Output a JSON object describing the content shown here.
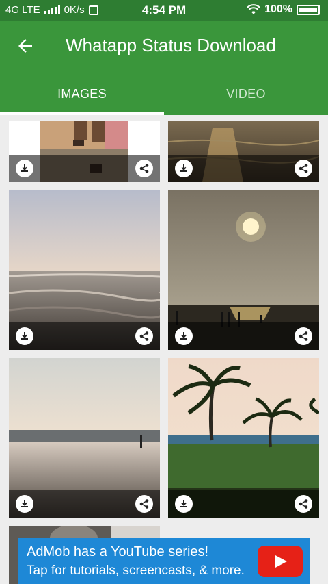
{
  "status_bar": {
    "network": "4G LTE",
    "speed": "0K/s",
    "time": "4:54 PM",
    "battery": "100%"
  },
  "app_bar": {
    "title": "Whatapp Status Download"
  },
  "tabs": [
    {
      "label": "IMAGES",
      "active": true
    },
    {
      "label": "VIDEO",
      "active": false
    }
  ],
  "ad": {
    "line1": "AdMob has a YouTube series!",
    "line2": "Tap for tutorials, screencasts, & more."
  },
  "colors": {
    "status_bar": "#2e7d32",
    "app_bar": "#3a963b",
    "ad_background": "#1e88d6",
    "youtube_red": "#e62117"
  }
}
